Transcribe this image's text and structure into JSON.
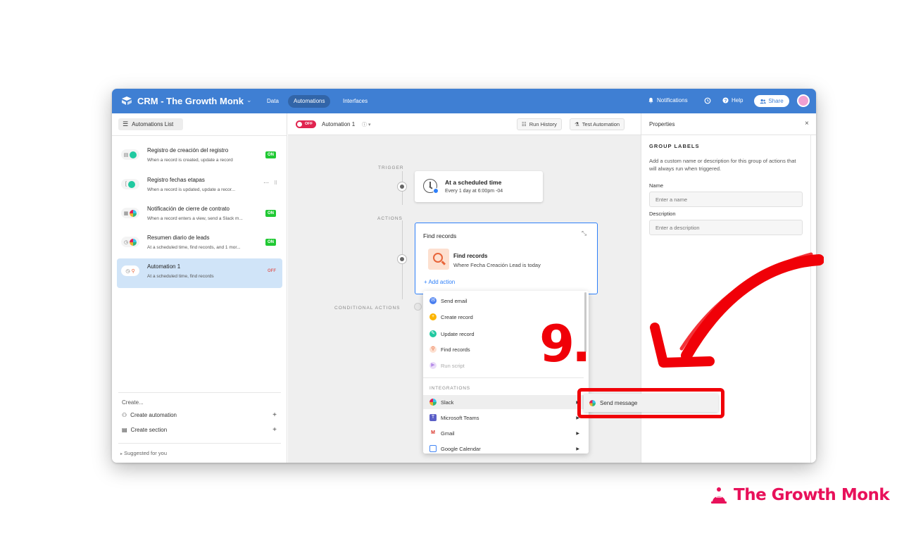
{
  "topbar": {
    "base_title": "CRM - The Growth Monk",
    "tabs": [
      "Data",
      "Automations",
      "Interfaces"
    ],
    "active_tab": "Automations",
    "notifications": "Notifications",
    "help": "Help",
    "share": "Share"
  },
  "sidebar": {
    "list_button": "Automations List",
    "automations": [
      {
        "title": "Registro de creación del registro",
        "subtitle": "When a record is created, update a record",
        "status": "ON"
      },
      {
        "title": "Registro fechas etapas",
        "subtitle": "When a record is updated, update a recor...",
        "status": ""
      },
      {
        "title": "Notificación de cierre de contrato",
        "subtitle": "When a record enters a view, send a Slack m...",
        "status": "ON"
      },
      {
        "title": "Resumen diario de leads",
        "subtitle": "At a scheduled time, find records, and 1 mor...",
        "status": "ON"
      },
      {
        "title": "Automation 1",
        "subtitle": "At a scheduled time, find records",
        "status": "OFF"
      }
    ],
    "create_label": "Create...",
    "create_automation": "Create automation",
    "create_section": "Create section",
    "suggested": "Suggested for you"
  },
  "canvas": {
    "toggle": "OFF",
    "automation_name": "Automation 1",
    "run_history": "Run History",
    "test_automation": "Test Automation",
    "trigger_label": "TRIGGER",
    "actions_label": "ACTIONS",
    "conditional_label": "CONDITIONAL ACTIONS",
    "trigger": {
      "title": "At a scheduled time",
      "subtitle": "Every 1 day at 6:00pm -04"
    },
    "action_card": {
      "title": "Find records",
      "step_title": "Find records",
      "step_subtitle": "Where Fecha Creación Lead is today",
      "add_action": "Add action"
    },
    "dropdown": {
      "items": [
        "Send email",
        "Create record",
        "Update record",
        "Find records",
        "Run script"
      ],
      "section": "INTEGRATIONS",
      "integrations": [
        "Slack",
        "Microsoft Teams",
        "Gmail",
        "Google Calendar"
      ]
    }
  },
  "properties": {
    "title": "Properties",
    "group_labels": "GROUP LABELS",
    "description_text": "Add a custom name or description for this group of actions that will always run when triggered.",
    "name_label": "Name",
    "name_placeholder": "Enter a name",
    "description_label": "Description",
    "description_placeholder": "Enter a description"
  },
  "annotation": {
    "submenu_item": "Send message",
    "step_number": "9.",
    "brand": "The Growth Monk"
  },
  "colors": {
    "topbar": "#3f7fd3",
    "accent": "#2d7ff9",
    "on_badge": "#20c933",
    "toggle_off": "#e0244f",
    "annotation_red": "#f00008",
    "brand_pink": "#e8115a"
  }
}
